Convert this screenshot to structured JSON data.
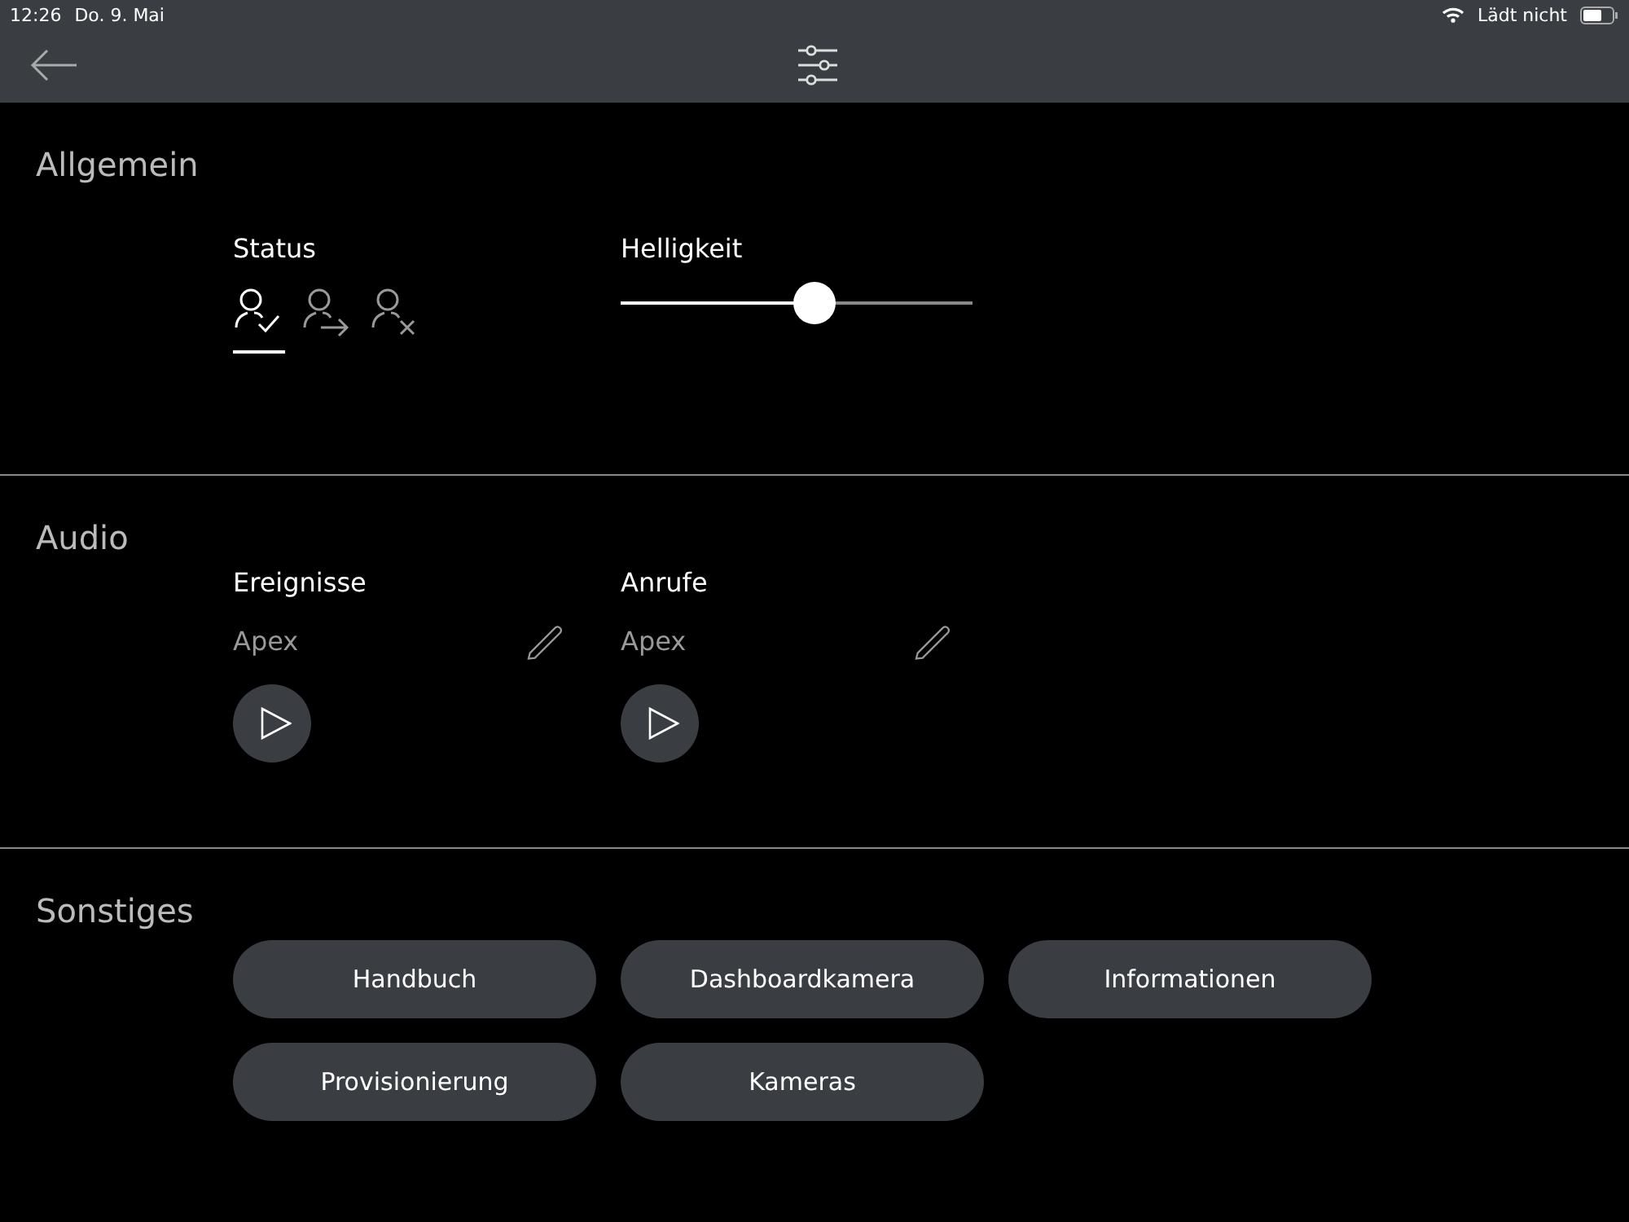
{
  "status_bar": {
    "time": "12:26",
    "date": "Do. 9. Mai",
    "charging": "Lädt nicht"
  },
  "sections": [
    {
      "kind": "general",
      "title": "Allgemein",
      "status": {
        "label": "Status",
        "options": [
          {
            "kind": "check",
            "selected": true
          },
          {
            "kind": "arrow",
            "selected": false
          },
          {
            "kind": "cross",
            "selected": false
          }
        ]
      },
      "brightness": {
        "label": "Helligkeit",
        "level": 0.55
      }
    },
    {
      "kind": "audio",
      "title": "Audio",
      "items": [
        {
          "label": "Ereignisse",
          "sound": "Apex"
        },
        {
          "label": "Anrufe",
          "sound": "Apex"
        }
      ]
    },
    {
      "kind": "buttons",
      "title": "Sonstiges",
      "buttons": [
        "Handbuch",
        "Dashboardkamera",
        "Informationen",
        "Provisionierung",
        "Kameras"
      ]
    }
  ]
}
